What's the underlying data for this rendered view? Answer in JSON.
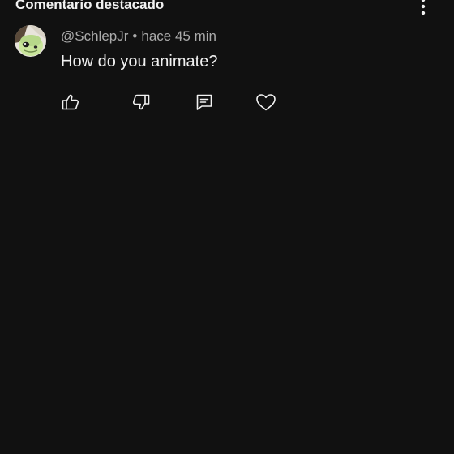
{
  "section": {
    "title": "Comentario destacado"
  },
  "comment": {
    "author": "@SchlepJr",
    "separator": "•",
    "time": "hace 45 min",
    "text": "How do you animate?"
  },
  "actions": [
    {
      "name": "like",
      "icon": "thumbs-up-icon"
    },
    {
      "name": "dislike",
      "icon": "thumbs-down-icon"
    },
    {
      "name": "reply",
      "icon": "comment-icon"
    },
    {
      "name": "heart",
      "icon": "heart-icon"
    }
  ],
  "colors": {
    "background": "#111111",
    "primary_text": "#f1f1f1",
    "secondary_text": "#aaaaaa",
    "icon": "#f1f1f1",
    "avatar_face": "#c9e59b"
  }
}
